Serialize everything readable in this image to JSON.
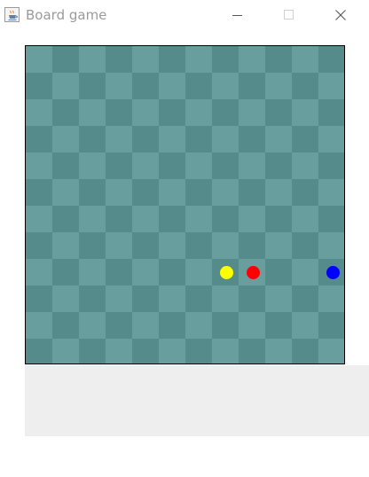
{
  "window": {
    "title": "Board game",
    "app_icon": "java-coffee-cup-icon",
    "controls": {
      "minimize": "minimize-icon",
      "maximize": "maximize-icon",
      "close": "close-icon"
    }
  },
  "board": {
    "rows": 12,
    "cols": 12,
    "light_color": "#689e9e",
    "dark_color": "#558b8a",
    "border_color": "#000000",
    "pieces": [
      {
        "name": "yellow-piece",
        "color": "#ffff00",
        "row": 8,
        "col": 7
      },
      {
        "name": "red-piece",
        "color": "#ff0000",
        "row": 8,
        "col": 8
      },
      {
        "name": "blue-piece",
        "color": "#0000ff",
        "row": 8,
        "col": 11
      }
    ]
  },
  "info_panel": {
    "background": "#eeeeee",
    "text": ""
  }
}
